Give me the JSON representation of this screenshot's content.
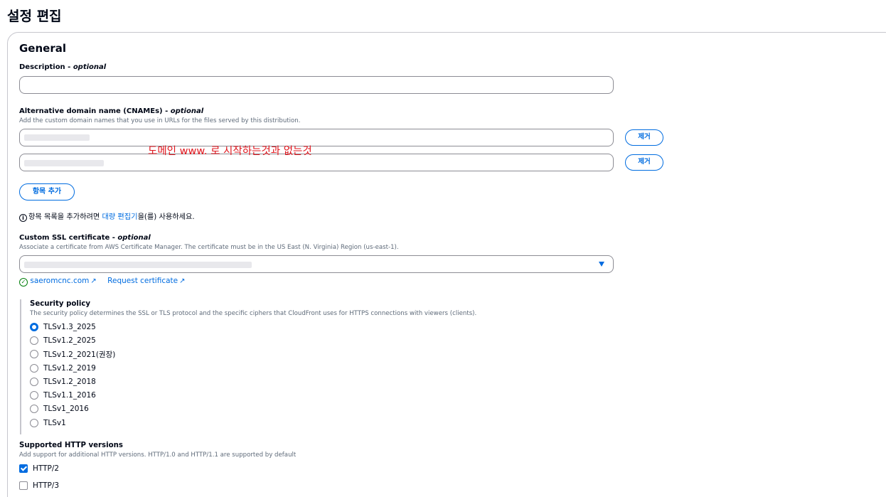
{
  "page_title": "설정 편집",
  "section_title": "General",
  "description": {
    "label": "Description",
    "optional": "optional",
    "value": ""
  },
  "cnames": {
    "label": "Alternative domain name (CNAMEs)",
    "optional": "optional",
    "desc": "Add the custom domain names that you use in URLs for the files served by this distribution.",
    "remove_label": "제거",
    "add_label": "항목 추가",
    "annotation": "도메인 www. 로 시작하는것과 없는것"
  },
  "info": {
    "before": "항목 목록을 추가하려면 ",
    "link": "대량 편집기",
    "after": "을(를) 사용하세요."
  },
  "ssl": {
    "label": "Custom SSL certificate",
    "optional": "optional",
    "desc": "Associate a certificate from AWS Certificate Manager. The certificate must be in the US East (N. Virginia) Region (us-east-1).",
    "domain_link": "saeromcnc.com",
    "request_link": "Request certificate"
  },
  "security_policy": {
    "title": "Security policy",
    "desc": "The security policy determines the SSL or TLS protocol and the specific ciphers that CloudFront uses for HTTPS connections with viewers (clients).",
    "options": [
      "TLSv1.3_2025",
      "TLSv1.2_2025",
      "TLSv1.2_2021(권장)",
      "TLSv1.2_2019",
      "TLSv1.2_2018",
      "TLSv1.1_2016",
      "TLSv1_2016",
      "TLSv1"
    ],
    "selected": "TLSv1.3_2025"
  },
  "http_versions": {
    "title": "Supported HTTP versions",
    "desc": "Add support for additional HTTP versions. HTTP/1.0 and HTTP/1.1 are supported by default",
    "options": [
      {
        "label": "HTTP/2",
        "checked": true
      },
      {
        "label": "HTTP/3",
        "checked": false
      }
    ]
  },
  "colors": {
    "accent": "#006ce0",
    "annotation": "#e0161d",
    "success": "#037f0c"
  }
}
